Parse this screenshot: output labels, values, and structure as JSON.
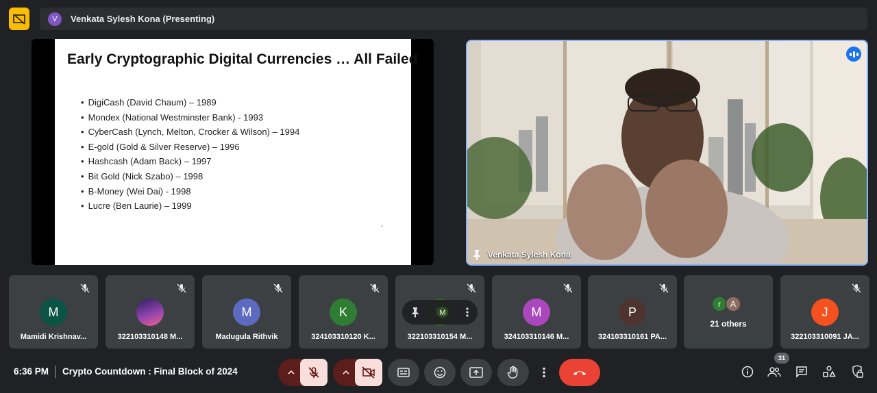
{
  "colors": {
    "background": "#202124",
    "tile": "#3c4043",
    "accent_yellow": "#fbbc04",
    "active_border": "#8ab4f8",
    "end_call": "#ea4335",
    "muted_button_bg": "#f9dedc"
  },
  "presenting": {
    "avatar_initial": "V",
    "label": "Venkata Sylesh Kona (Presenting)"
  },
  "slide": {
    "title": "Early Cryptographic Digital Currencies … All Failed",
    "bullets": [
      "DigiCash (David Chaum) – 1989",
      "Mondex (National Westminster Bank) - 1993",
      "CyberCash (Lynch, Melton, Crocker & Wilson) – 1994",
      "E-gold (Gold & Silver Reserve) – 1996",
      "Hashcash (Adam Back) – 1997",
      "Bit Gold (Nick Szabo) – 1998",
      "B-Money (Wei Dai) - 1998",
      "Lucre (Ben Laurie) – 1999"
    ]
  },
  "presenter_video": {
    "name": "Venkata Sylesh Kona",
    "pin_icon": "pin-icon",
    "speaking_icon": "audio-level-icon"
  },
  "participants": [
    {
      "initial": "M",
      "name": "Mamidi Krishnav...",
      "color": "#0b5345"
    },
    {
      "initial": "",
      "name": "322103310148 M...",
      "color": "#5b3a8c",
      "photo": true
    },
    {
      "initial": "M",
      "name": "Madugula Rithvik",
      "color": "#5c6bc0"
    },
    {
      "initial": "K",
      "name": "324103310120 K...",
      "color": "#2e7d32"
    },
    {
      "initial": "M",
      "name": "322103310154 M...",
      "color": "#33691e",
      "hover": true
    },
    {
      "initial": "M",
      "name": "324103310146 M...",
      "color": "#ab47bc"
    },
    {
      "initial": "P",
      "name": "324103310161 PA...",
      "color": "#4e342e"
    },
    {
      "others": true,
      "avatars": [
        "r",
        "A"
      ],
      "name": "21 others"
    },
    {
      "initial": "J",
      "name": "322103310091 JA...",
      "color": "#f4511e"
    }
  ],
  "bottom_bar": {
    "time": "6:36 PM",
    "meeting_title": "Crypto Countdown : Final Block of 2024",
    "participant_count": "31"
  }
}
